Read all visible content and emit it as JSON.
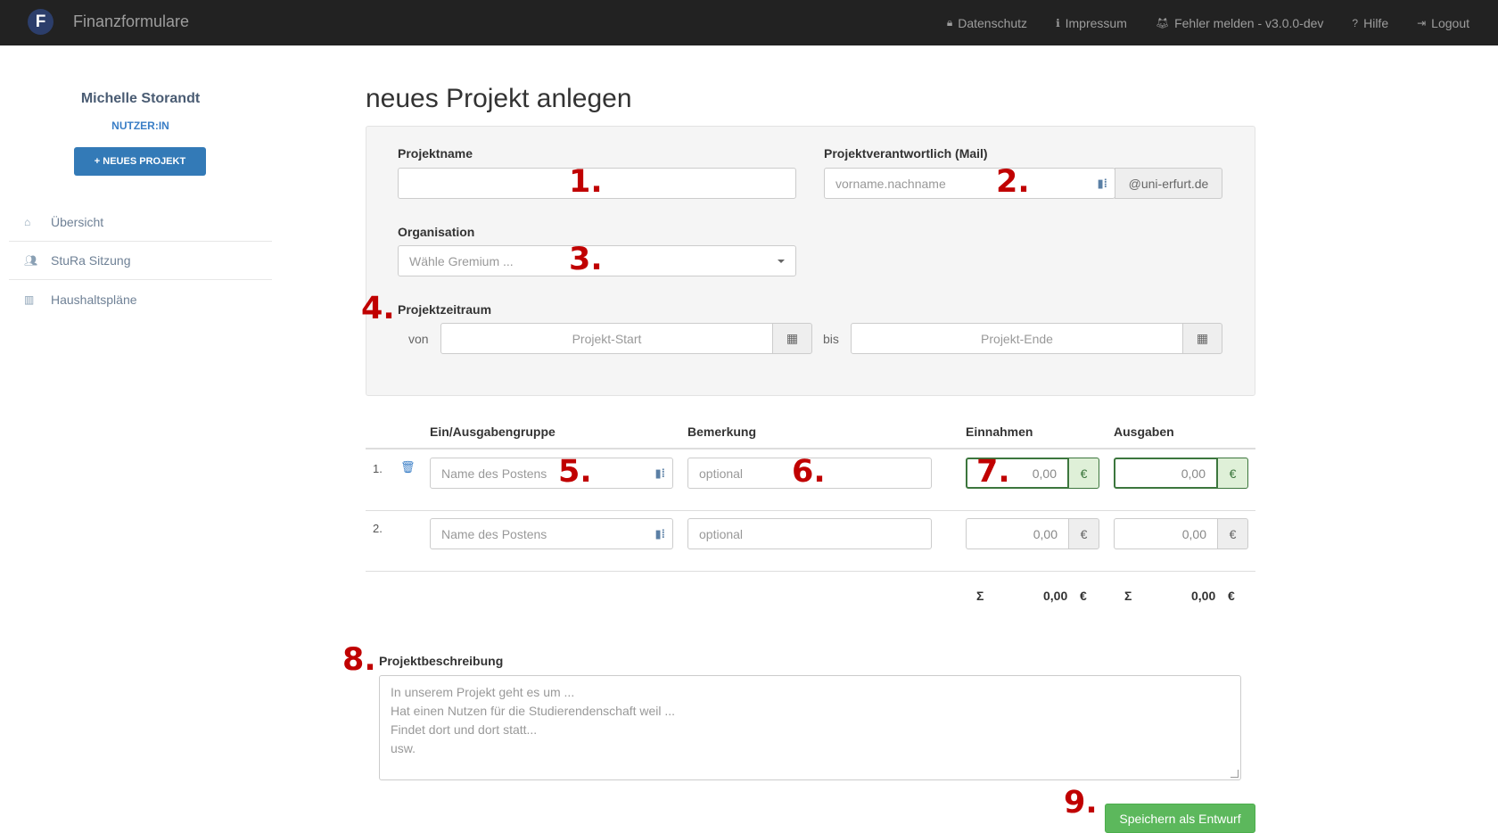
{
  "app": {
    "logo_letter": "F",
    "title": "Finanzformulare"
  },
  "nav": {
    "items": [
      {
        "icon": "lock-icon",
        "glyph": "🔒︎",
        "label": "Datenschutz"
      },
      {
        "icon": "info-icon",
        "glyph": "ℹ",
        "label": "Impressum"
      },
      {
        "icon": "gitlab-icon",
        "glyph": "🦊︎",
        "label": "Fehler melden - v3.0.0-dev"
      },
      {
        "icon": "question-icon",
        "glyph": "?",
        "label": "Hilfe"
      },
      {
        "icon": "logout-icon",
        "glyph": "⇥",
        "label": "Logout"
      }
    ]
  },
  "sidebar": {
    "user_name": "Michelle Storandt",
    "user_role": "NUTZER:IN",
    "new_project_label": "+ NEUES PROJEKT",
    "items": [
      {
        "icon": "home-icon",
        "glyph": "⌂",
        "label": "Übersicht"
      },
      {
        "icon": "users-icon",
        "glyph": "👥︎",
        "label": "StuRa Sitzung"
      },
      {
        "icon": "bar-chart-icon",
        "glyph": "▥",
        "label": "Haushaltspläne"
      }
    ]
  },
  "form": {
    "title": "neues Projekt anlegen",
    "project_name_label": "Projektname",
    "project_name_value": "",
    "responsible_label": "Projektverantwortlich (Mail)",
    "responsible_placeholder": "vorname.nachname",
    "responsible_domain": "@uni-erfurt.de",
    "organisation_label": "Organisation",
    "organisation_placeholder": "Wähle Gremium ...",
    "period_label": "Projektzeitraum",
    "from_label": "von",
    "start_placeholder": "Projekt-Start",
    "to_label": "bis",
    "end_placeholder": "Projekt-Ende",
    "calendar_glyph": "▦"
  },
  "table": {
    "headers": {
      "group": "Ein/Ausgabengruppe",
      "remark": "Bemerkung",
      "income": "Einnahmen",
      "expenses": "Ausgaben"
    },
    "rows": [
      {
        "index": "1.",
        "name_placeholder": "Name des Postens",
        "remark_placeholder": "optional",
        "income": "0,00",
        "expenses": "0,00",
        "currency": "€"
      },
      {
        "index": "2.",
        "name_placeholder": "Name des Postens",
        "remark_placeholder": "optional",
        "income": "0,00",
        "expenses": "0,00",
        "currency": "€"
      }
    ],
    "sum_symbol": "Σ",
    "income_total": "0,00",
    "expenses_total": "0,00",
    "currency": "€",
    "trash_glyph": "🗑︎",
    "kb_glyph": "▮⁞"
  },
  "description": {
    "label": "Projektbeschreibung",
    "placeholder_lines": [
      "In unserem Projekt geht es um ...",
      "Hat einen Nutzen für die Studierendenschaft weil ...",
      "Findet dort und dort statt...",
      "usw."
    ]
  },
  "save_label": "Speichern als Entwurf",
  "annotations": [
    "1.",
    "2.",
    "3.",
    "4.",
    "5.",
    "6.",
    "7.",
    "8.",
    "9."
  ],
  "colors": {
    "navbar": "#222222",
    "primary": "#337ab7",
    "success": "#5cb85c",
    "annotation": "#c00000"
  }
}
